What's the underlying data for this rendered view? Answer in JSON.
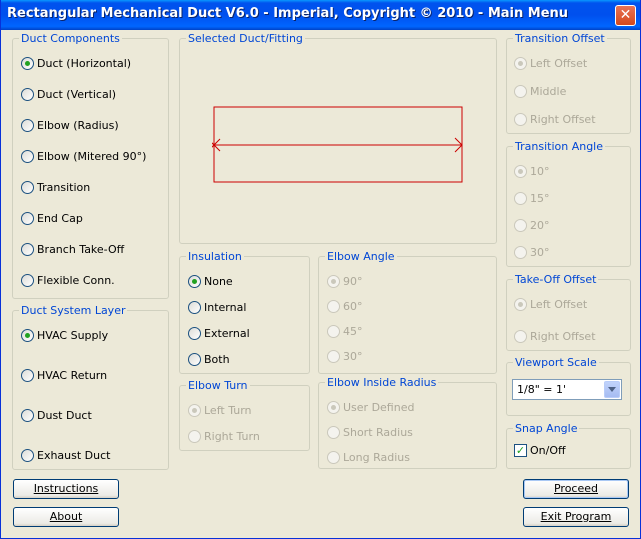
{
  "window": {
    "title": "Rectangular Mechanical Duct V6.0 - Imperial, Copyright © 2010 - Main Menu",
    "close_glyph": "✕"
  },
  "duct_components": {
    "label": "Duct Components",
    "items": [
      {
        "label": "Duct (Horizontal)",
        "checked": true
      },
      {
        "label": "Duct (Vertical)",
        "checked": false
      },
      {
        "label": "Elbow (Radius)",
        "checked": false
      },
      {
        "label": "Elbow (Mitered 90°)",
        "checked": false
      },
      {
        "label": "Transition",
        "checked": false
      },
      {
        "label": "End Cap",
        "checked": false
      },
      {
        "label": "Branch Take-Off",
        "checked": false
      },
      {
        "label": "Flexible Conn.",
        "checked": false
      }
    ]
  },
  "duct_system_layer": {
    "label": "Duct System Layer",
    "items": [
      {
        "label": "HVAC Supply",
        "checked": true
      },
      {
        "label": "HVAC Return",
        "checked": false
      },
      {
        "label": "Dust Duct",
        "checked": false
      },
      {
        "label": "Exhaust Duct",
        "checked": false
      }
    ]
  },
  "selected_fitting": {
    "label": "Selected Duct/Fitting",
    "line_color": "#cc0000"
  },
  "insulation": {
    "label": "Insulation",
    "items": [
      {
        "label": "None",
        "checked": true
      },
      {
        "label": "Internal",
        "checked": false
      },
      {
        "label": "External",
        "checked": false
      },
      {
        "label": "Both",
        "checked": false
      }
    ]
  },
  "elbow_turn": {
    "label": "Elbow Turn",
    "items": [
      {
        "label": "Left Turn",
        "checked": true
      },
      {
        "label": "Right Turn",
        "checked": false
      }
    ]
  },
  "elbow_angle": {
    "label": "Elbow Angle",
    "items": [
      {
        "label": "90°",
        "checked": true
      },
      {
        "label": "60°",
        "checked": false
      },
      {
        "label": "45°",
        "checked": false
      },
      {
        "label": "30°",
        "checked": false
      }
    ]
  },
  "elbow_inside_radius": {
    "label": "Elbow Inside Radius",
    "items": [
      {
        "label": "User Defined",
        "checked": true
      },
      {
        "label": "Short Radius",
        "checked": false
      },
      {
        "label": "Long Radius",
        "checked": false
      }
    ]
  },
  "transition_offset": {
    "label": "Transition Offset",
    "items": [
      {
        "label": "Left Offset",
        "checked": true
      },
      {
        "label": "Middle",
        "checked": false
      },
      {
        "label": "Right Offset",
        "checked": false
      }
    ]
  },
  "transition_angle": {
    "label": "Transition Angle",
    "items": [
      {
        "label": "10°",
        "checked": true
      },
      {
        "label": "15°",
        "checked": false
      },
      {
        "label": "20°",
        "checked": false
      },
      {
        "label": "30°",
        "checked": false
      }
    ]
  },
  "takeoff_offset": {
    "label": "Take-Off Offset",
    "items": [
      {
        "label": "Left Offset",
        "checked": true
      },
      {
        "label": "Right Offset",
        "checked": false
      }
    ]
  },
  "viewport_scale": {
    "label": "Viewport Scale",
    "value": "1/8\" = 1'"
  },
  "snap_angle": {
    "label": "Snap Angle",
    "checkbox_label": "On/Off",
    "checked": true,
    "check_glyph": "✓"
  },
  "buttons": {
    "instructions": "Instructions",
    "about": "About",
    "proceed": "Proceed",
    "exit": "Exit Program"
  }
}
